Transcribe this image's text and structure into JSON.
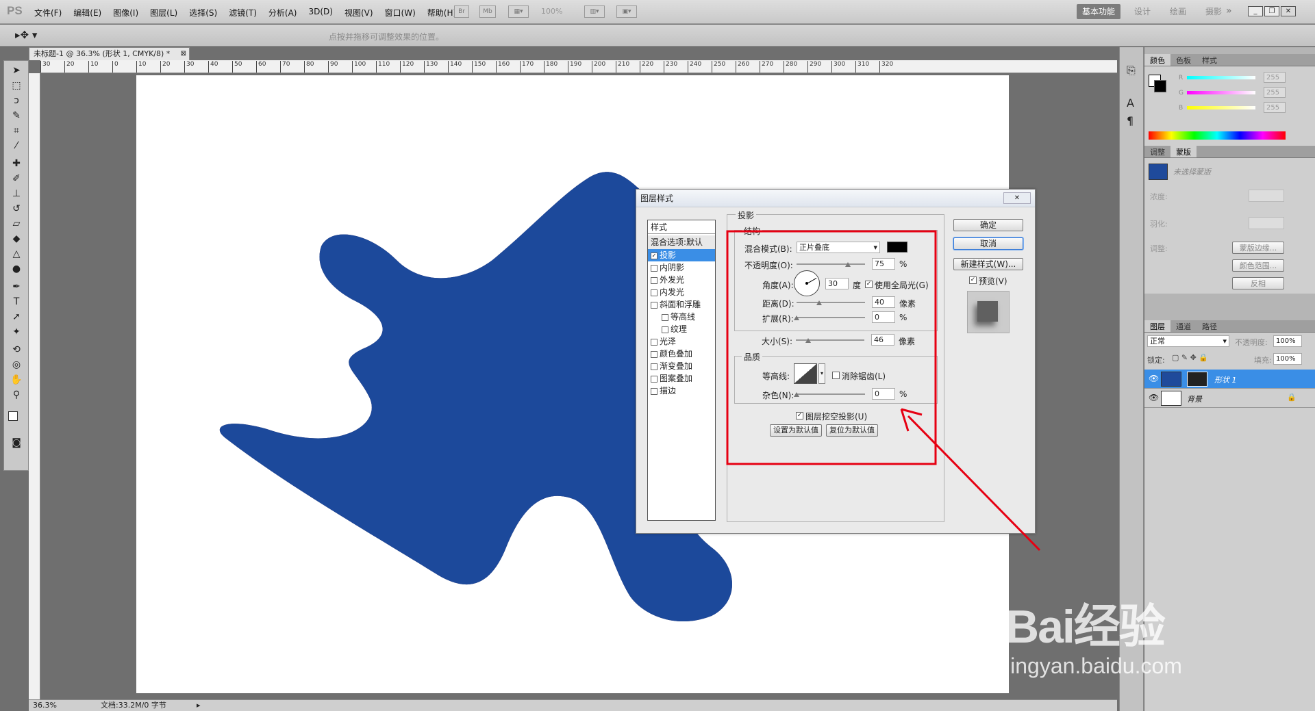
{
  "menubar": {
    "logo": "PS",
    "menus": [
      "文件(F)",
      "编辑(E)",
      "图像(I)",
      "图层(L)",
      "选择(S)",
      "滤镜(T)",
      "分析(A)",
      "3D(D)",
      "视图(V)",
      "窗口(W)",
      "帮助(H)"
    ],
    "zoom": "100%",
    "workspaces": [
      "基本功能",
      "设计",
      "绘画",
      "摄影"
    ]
  },
  "options": {
    "hint": "点按并拖移可调整效果的位置。"
  },
  "document": {
    "tab_title": "未标题-1 @ 36.3% (形状 1, CMYK/8) *",
    "shape_color": "#1f4a9b",
    "ruler_ticks": [
      "30",
      "20",
      "10",
      "0",
      "10",
      "20",
      "30",
      "40",
      "50",
      "60",
      "70",
      "80",
      "90",
      "100",
      "110",
      "120",
      "130",
      "140",
      "150",
      "160",
      "170",
      "180",
      "190",
      "200",
      "210",
      "220",
      "230",
      "240",
      "250",
      "260",
      "270",
      "280",
      "290",
      "300",
      "310",
      "320"
    ]
  },
  "status": {
    "zoom": "36.3%",
    "doc_info": "文档:33.2M/0 字节"
  },
  "dialog": {
    "title": "图层样式",
    "styles_header": "样式",
    "blend_default": "混合选项:默认",
    "effects": [
      {
        "label": "投影",
        "checked": true,
        "selected": true,
        "indent": false
      },
      {
        "label": "内阴影",
        "checked": false,
        "indent": false
      },
      {
        "label": "外发光",
        "checked": false,
        "indent": false
      },
      {
        "label": "内发光",
        "checked": false,
        "indent": false
      },
      {
        "label": "斜面和浮雕",
        "checked": false,
        "indent": false
      },
      {
        "label": "等高线",
        "checked": false,
        "indent": true
      },
      {
        "label": "纹理",
        "checked": false,
        "indent": true
      },
      {
        "label": "光泽",
        "checked": false,
        "indent": false
      },
      {
        "label": "颜色叠加",
        "checked": false,
        "indent": false
      },
      {
        "label": "渐变叠加",
        "checked": false,
        "indent": false
      },
      {
        "label": "图案叠加",
        "checked": false,
        "indent": false
      },
      {
        "label": "描边",
        "checked": false,
        "indent": false
      }
    ],
    "section_title": "投影",
    "structure_title": "结构",
    "blend_mode_label": "混合模式(B):",
    "blend_mode_value": "正片叠底",
    "shadow_color": "#000000",
    "opacity_label": "不透明度(O):",
    "opacity_value": "75",
    "angle_label": "角度(A):",
    "angle_value": "30",
    "angle_unit": "度",
    "global_light_label": "使用全局光(G)",
    "global_light_checked": true,
    "distance_label": "距离(D):",
    "distance_value": "40",
    "spread_label": "扩展(R):",
    "spread_value": "0",
    "size_label": "大小(S):",
    "size_value": "46",
    "pixel_unit": "像素",
    "percent_unit": "%",
    "quality_title": "品质",
    "contour_label": "等高线:",
    "antialias_label": "消除锯齿(L)",
    "noise_label": "杂色(N):",
    "noise_value": "0",
    "knockout_label": "图层挖空投影(U)",
    "set_default_label": "设置为默认值",
    "reset_default_label": "复位为默认值",
    "ok_label": "确定",
    "cancel_label": "取消",
    "new_style_label": "新建样式(W)...",
    "preview_label": "预览(V)"
  },
  "panels": {
    "color_tabs": [
      "颜色",
      "色板",
      "样式"
    ],
    "color_channels": [
      {
        "label": "R",
        "value": "255"
      },
      {
        "label": "G",
        "value": "255"
      },
      {
        "label": "B",
        "value": "255"
      }
    ],
    "adjust_tabs": [
      "调整",
      "蒙版"
    ],
    "mask_label": "未选择蒙版",
    "density_label": "浓度:",
    "feather_label": "羽化:",
    "refine_label": "调整:",
    "mask_edge_btn": "蒙版边缘...",
    "color_range_btn": "颜色范围...",
    "invert_btn": "反相",
    "layer_tabs": [
      "图层",
      "通道",
      "路径"
    ],
    "blend_mode": "正常",
    "opacity_label": "不透明度:",
    "opacity_value": "100%",
    "lock_label": "锁定:",
    "fill_label": "填充:",
    "fill_value": "100%",
    "layers": [
      {
        "name": "形状 1",
        "selected": true,
        "thumb_color": "#1f4a9b"
      },
      {
        "name": "背景",
        "selected": false,
        "thumb_color": "#ffffff"
      }
    ]
  },
  "watermark": {
    "text": "Bai经验",
    "url": "jingyan.baidu.com"
  }
}
